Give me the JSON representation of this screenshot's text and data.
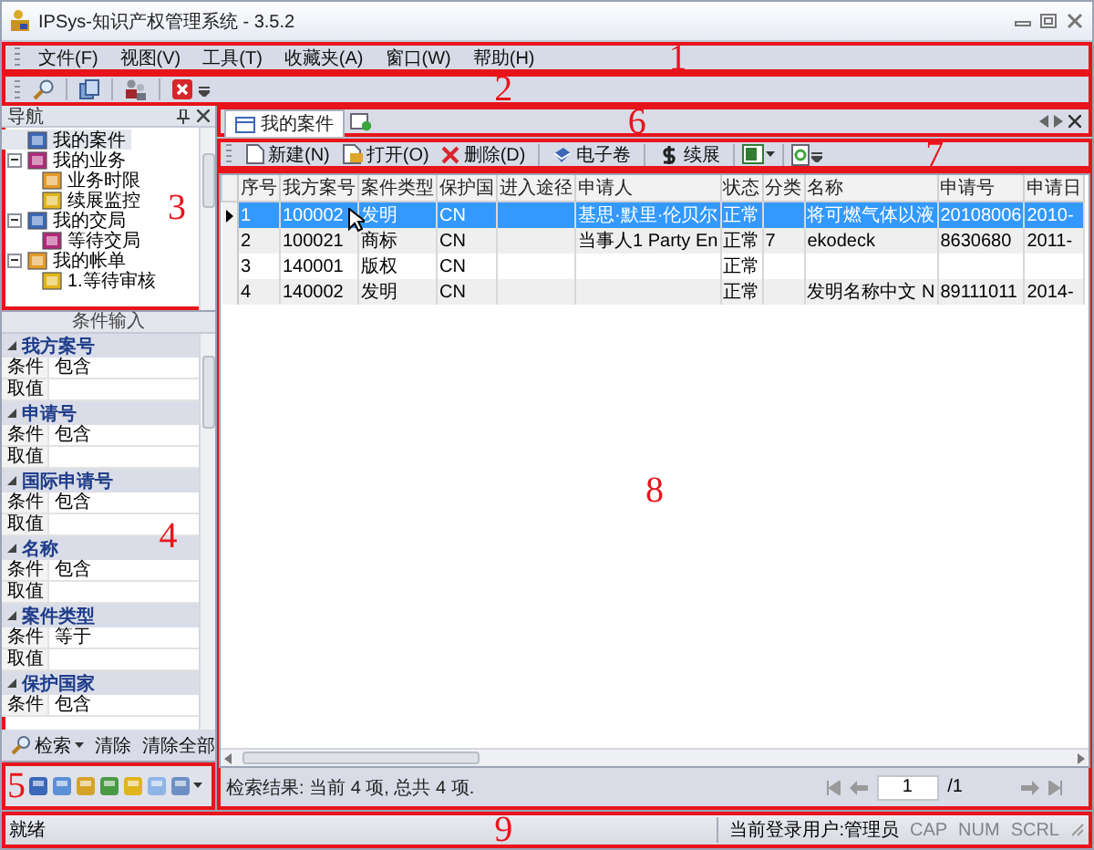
{
  "window": {
    "title": "IPSys-知识产权管理系统 - 3.5.2"
  },
  "menu_bar": {
    "annotation": "1",
    "items": [
      "文件(F)",
      "视图(V)",
      "工具(T)",
      "收藏夹(A)",
      "窗口(W)",
      "帮助(H)"
    ]
  },
  "toolbar": {
    "annotation": "2"
  },
  "navigation": {
    "annotation": "3",
    "title": "导航",
    "items": [
      {
        "label": "我的案件",
        "selected": true
      },
      {
        "label": "我的业务",
        "selected": false,
        "expanded": true,
        "children": [
          {
            "label": "业务时限",
            "selected": false
          },
          {
            "label": "续展监控",
            "selected": false
          }
        ]
      },
      {
        "label": "我的交局",
        "selected": false,
        "expanded": true,
        "children": [
          {
            "label": "等待交局",
            "selected": false
          }
        ]
      },
      {
        "label": "我的帐单",
        "selected": false,
        "expanded": true,
        "children": [
          {
            "label": "1.等待审核",
            "selected": false
          }
        ]
      }
    ]
  },
  "conditions": {
    "annotation": "4",
    "title": "条件输入",
    "groups": [
      {
        "name": "我方案号",
        "expanded": true,
        "rows": [
          {
            "label": "条件",
            "value": "包含"
          },
          {
            "label": "取值"
          }
        ]
      },
      {
        "name": "申请号",
        "expanded": true,
        "rows": [
          {
            "label": "条件",
            "value": "包含"
          },
          {
            "label": "取值"
          }
        ]
      },
      {
        "name": "国际申请号",
        "expanded": true,
        "rows": [
          {
            "label": "条件",
            "value": "包含"
          },
          {
            "label": "取值"
          }
        ]
      },
      {
        "name": "名称",
        "expanded": true,
        "rows": [
          {
            "label": "条件",
            "value": "包含"
          },
          {
            "label": "取值"
          }
        ]
      },
      {
        "name": "案件类型",
        "expanded": true,
        "rows": [
          {
            "label": "条件",
            "value": "等于"
          },
          {
            "label": "取值"
          }
        ]
      },
      {
        "name": "保护国家",
        "expanded": true,
        "rows": [
          {
            "label": "条件",
            "value": "包含"
          }
        ]
      }
    ],
    "actions": [
      "检索",
      "清除",
      "清除全部"
    ]
  },
  "icon_bar": {
    "annotation": "5"
  },
  "tabs": {
    "annotation": "6",
    "items": [
      {
        "label": "我的案件",
        "selected": true
      }
    ]
  },
  "case_toolbar": {
    "annotation": "7",
    "buttons": [
      {
        "label": "新建(N)",
        "kind": "new"
      },
      {
        "label": "打开(O)",
        "kind": "open"
      },
      {
        "label": "删除(D)",
        "kind": "delete"
      },
      {
        "label": "电子卷",
        "kind": "ebook"
      },
      {
        "label": "续展",
        "kind": "renew"
      }
    ]
  },
  "grid": {
    "annotation": "8",
    "columns": [
      "序号",
      "我方案号",
      "案件类型",
      "保护国",
      "进入途径",
      "申请人",
      "状态",
      "分类",
      "名称",
      "申请号",
      "申请日"
    ],
    "rows": [
      {
        "selected": true,
        "cells": [
          "1",
          "100002",
          "发明",
          "CN",
          null,
          "基思·默里·伦贝尔",
          "正常",
          null,
          "将可燃气体以液",
          "20108006",
          "2010-"
        ]
      },
      {
        "selected": false,
        "cells": [
          "2",
          "100021",
          "商标",
          "CN",
          null,
          "当事人1 Party En",
          "正常",
          "7",
          "ekodeck",
          "8630680",
          "2011-"
        ]
      },
      {
        "selected": false,
        "cells": [
          "3",
          "140001",
          "版权",
          "CN",
          null,
          null,
          "正常",
          null,
          null,
          null,
          null
        ]
      },
      {
        "selected": false,
        "cells": [
          "4",
          "140002",
          "发明",
          "CN",
          null,
          null,
          "正常",
          null,
          "发明名称中文 N",
          "89111011",
          "2014-"
        ]
      }
    ]
  },
  "footer": {
    "summary": "检索结果: 当前 4 项, 总共 4 项.",
    "page": "1",
    "page_total": "/1"
  },
  "status_bar": {
    "annotation": "9",
    "message": "就绪",
    "user": "当前登录用户:管理员",
    "indicators": [
      {
        "label": "CAP",
        "active": false
      },
      {
        "label": "NUM",
        "active": false
      },
      {
        "label": "SCRL",
        "active": false
      }
    ]
  }
}
